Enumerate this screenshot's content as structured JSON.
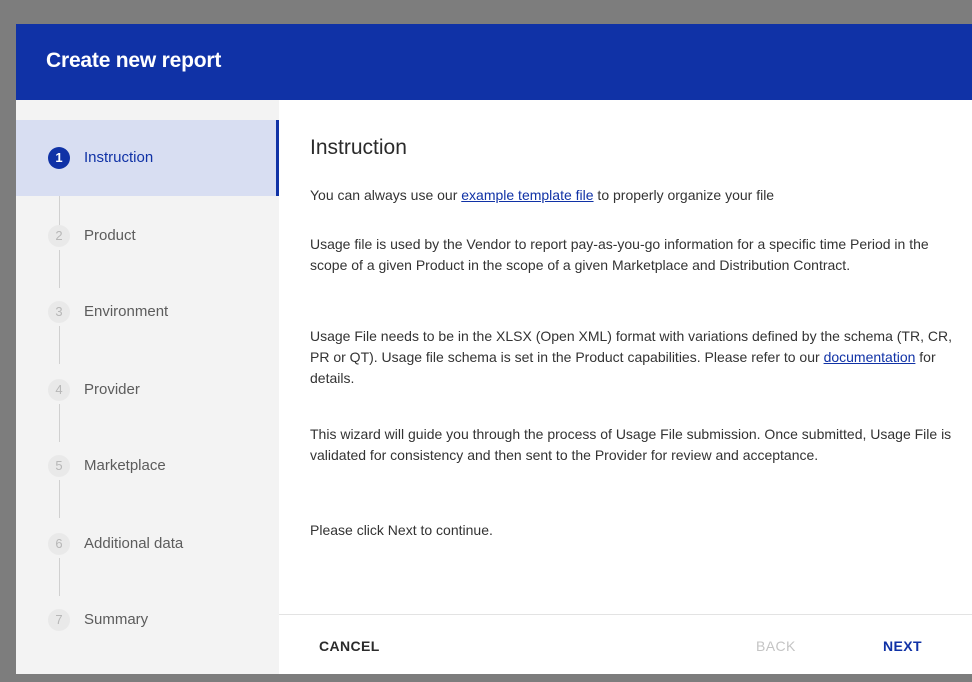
{
  "dialog": {
    "title": "Create new report"
  },
  "steps": [
    {
      "number": "1",
      "label": "Instruction",
      "active": true
    },
    {
      "number": "2",
      "label": "Product",
      "active": false
    },
    {
      "number": "3",
      "label": "Environment",
      "active": false
    },
    {
      "number": "4",
      "label": "Provider",
      "active": false
    },
    {
      "number": "5",
      "label": "Marketplace",
      "active": false
    },
    {
      "number": "6",
      "label": "Additional data",
      "active": false
    },
    {
      "number": "7",
      "label": "Summary",
      "active": false
    }
  ],
  "content": {
    "title": "Instruction",
    "p1_before": "You can always use our ",
    "p1_link": "example template file",
    "p1_after": " to properly organize your file",
    "p2": "Usage file is used by the Vendor to report pay-as-you-go information for a specific time Period in the scope of a given Product in the scope of a given Marketplace and Distribution Contract.",
    "p3_before": "Usage File needs to be in the XLSX (Open XML) format with variations defined by the schema (TR, CR, PR or QT). Usage file schema is set in the Product capabilities. Please refer to our ",
    "p3_link": "documentation",
    "p3_after": " for details.",
    "p4": "This wizard will guide you through the process of Usage File submission. Once submitted, Usage File is validated for consistency and then sent to the Provider for review and acceptance.",
    "p5": "Please click Next to continue."
  },
  "footer": {
    "cancel_label": "CANCEL",
    "back_label": "BACK",
    "next_label": "NEXT"
  },
  "colors": {
    "primary": "#1032a6",
    "active_step_bg": "#d8def2",
    "disabled_text": "#c4c4c4"
  }
}
